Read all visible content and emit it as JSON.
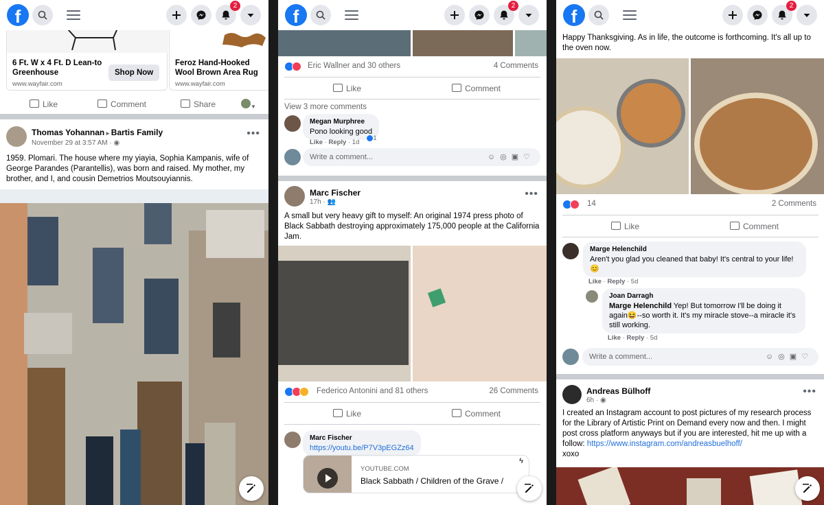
{
  "colors": {
    "brand": "#1877f2",
    "badge": "#e41e3f",
    "link": "#216fdb"
  },
  "nav": {
    "logo_letter": "f",
    "notification_count": "2",
    "icons": [
      "facebook-logo",
      "search-icon",
      "menu-icon",
      "plus-icon",
      "messenger-icon",
      "bell-icon",
      "caret-down-icon"
    ]
  },
  "screen1": {
    "ad": {
      "card1_title": "6 Ft. W x 4 Ft. D Lean-to Greenhouse",
      "card1_url": "www.wayfair.com",
      "shop_now": "Shop Now",
      "card2_title": "Feroz Hand-Hooked Wool Brown Area Rug",
      "card2_url": "www.wayfair.com",
      "actions": {
        "like": "Like",
        "comment": "Comment",
        "share": "Share"
      }
    },
    "post": {
      "author": "Thomas Yohannan",
      "target": "Bartis Family",
      "time": "November 29 at 3:57 AM",
      "text": "1959. Plomari. The house where my yiayia, Sophia Kampanis, wife of George Parandes (Parantellis), was born and raised. My mother, my brother, and I, and cousin Demetrios Moutsouyiannis."
    }
  },
  "screen2": {
    "post1": {
      "reactions": "Eric Wallner and 30 others",
      "comments_count": "4 Comments",
      "like": "Like",
      "comment": "Comment",
      "view_more": "View 3 more comments",
      "c1_name": "Megan Murphree",
      "c1_text": "Pono looking good",
      "c1_like": "Like",
      "c1_reply": "Reply",
      "c1_time": "1d",
      "c1_reacts": "1",
      "write_placeholder": "Write a comment..."
    },
    "post2": {
      "author": "Marc Fischer",
      "time": "17h",
      "text": "A small but very heavy gift to myself: An original 1974 press photo of Black Sabbath destroying approximately 175,000 people at the California Jam.",
      "reactions": "Federico Antonini and 81 others",
      "comments_count": "26 Comments",
      "like": "Like",
      "comment": "Comment",
      "c1_name": "Marc Fischer",
      "c1_link": "https://youtu.be/P7V3pEGZz64",
      "preview_domain": "YOUTUBE.COM",
      "preview_title": "Black Sabbath / Children of the Grave /"
    }
  },
  "screen3": {
    "post1": {
      "text": "Happy Thanksgiving. As in life, the outcome is forthcoming. It's all up to the oven now.",
      "reactions": "14",
      "comments_count": "2 Comments",
      "like": "Like",
      "comment": "Comment",
      "c1_name": "Marge Helenchild",
      "c1_text": "Aren't you glad you cleaned that baby! It's central to your life! 😊",
      "c1_like": "Like",
      "c1_reply": "Reply",
      "c1_time": "5d",
      "c2_name": "Joan Darragh",
      "c2_mention": "Marge Helenchild",
      "c2_text": " Yep! But tomorrow I'll be doing it again😆--so worth it. It's my miracle stove--a miracle it's still working.",
      "c2_like": "Like",
      "c2_reply": "Reply",
      "c2_time": "5d",
      "write_placeholder": "Write a comment..."
    },
    "post2": {
      "author": "Andreas Bülhoff",
      "time": "6h",
      "text": "I created an Instagram account to post pictures of my research process for the Library of Artistic Print on Demand every now and then. I might post cross platform anyways but if you are interested, hit me up with a follow: ",
      "link": "https://www.instagram.com/andreasbuelhoff/",
      "text_end": "xoxo"
    }
  }
}
